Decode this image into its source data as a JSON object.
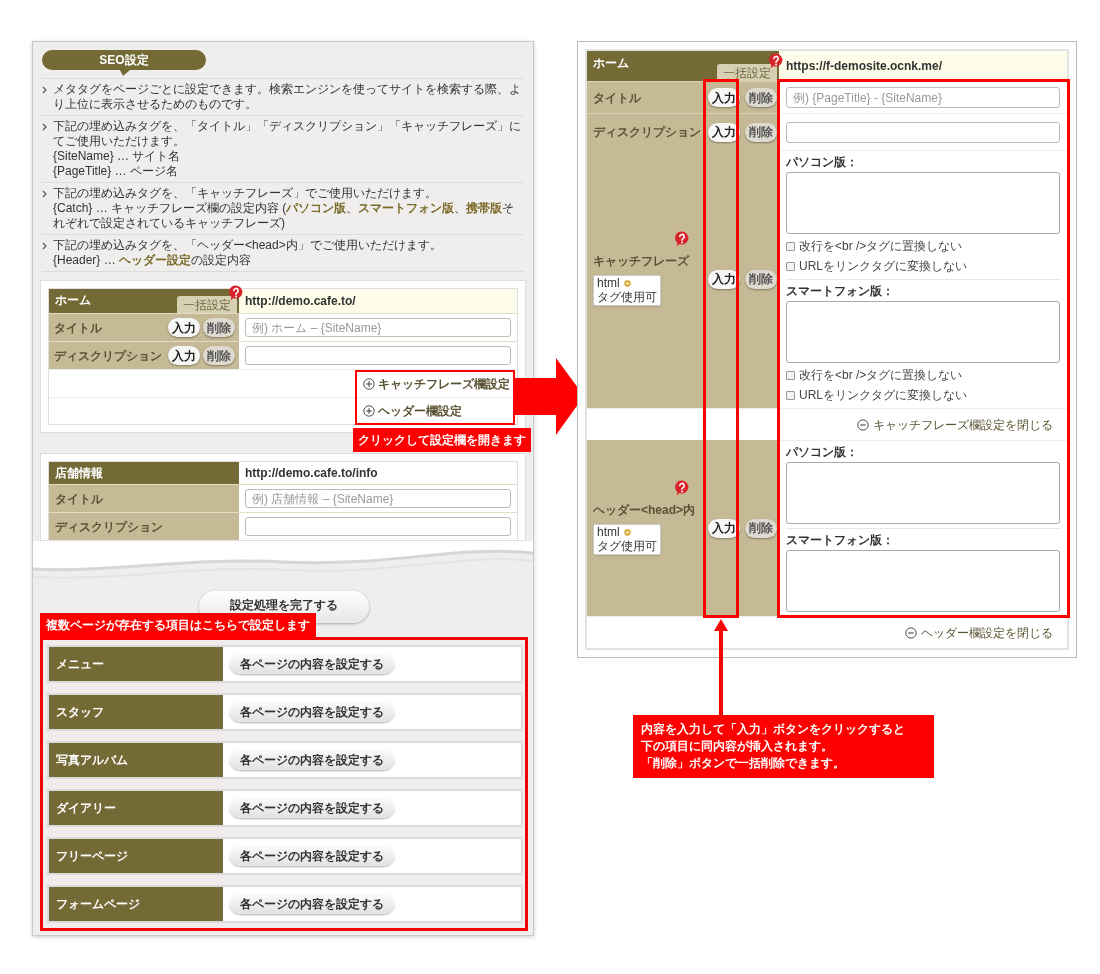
{
  "left_panel": {
    "section_title": "SEO設定",
    "notes": [
      {
        "lines": [
          [
            {
              "kind": "plain",
              "text": "メタタグをページごとに設定できます。検索エンジンを使ってサイトを検索する際、より上位に表示させるためのものです。"
            }
          ]
        ]
      },
      {
        "lines": [
          [
            {
              "kind": "plain",
              "text": "下記の埋め込みタグを、「タイトル」「ディスクリプション」「キャッチフレーズ」にてご使用いただけます。"
            }
          ],
          [
            {
              "kind": "plain",
              "text": "{SiteName} … サイト名"
            }
          ],
          [
            {
              "kind": "plain",
              "text": "{PageTitle} … ページ名"
            }
          ]
        ]
      },
      {
        "lines": [
          [
            {
              "kind": "plain",
              "text": "下記の埋め込みタグを、「キャッチフレーズ」でご使用いただけます。"
            }
          ],
          [
            {
              "kind": "plain",
              "text": "{Catch} … キャッチフレーズ欄の設定内容 ("
            },
            {
              "kind": "link",
              "text": "パソコン版"
            },
            {
              "kind": "plain",
              "text": "、"
            },
            {
              "kind": "link",
              "text": "スマートフォン版"
            },
            {
              "kind": "plain",
              "text": "、"
            },
            {
              "kind": "link",
              "text": "携帯版"
            },
            {
              "kind": "plain",
              "text": "それぞれで設定されているキャッチフレーズ)"
            }
          ]
        ]
      },
      {
        "lines": [
          [
            {
              "kind": "plain",
              "text": "下記の埋め込みタグを、「ヘッダー<head>内」でご使用いただけます。"
            }
          ],
          [
            {
              "kind": "plain",
              "text": "{Header} … "
            },
            {
              "kind": "link",
              "text": "ヘッダー設定"
            },
            {
              "kind": "plain",
              "text": "の設定内容"
            }
          ]
        ]
      }
    ],
    "home": {
      "name": "ホーム",
      "bulk_label": "一括設定",
      "url": "http://demo.cafe.to/",
      "rows": [
        {
          "label": "タイトル",
          "input_button": "入力",
          "delete_button": "削除",
          "placeholder": "例) ホーム – {SiteName}"
        },
        {
          "label": "ディスクリプション",
          "input_button": "入力",
          "delete_button": "削除"
        }
      ],
      "links": [
        "キャッチフレーズ欄設定",
        "ヘッダー欄設定"
      ]
    },
    "shop": {
      "name": "店舗情報",
      "url": "http://demo.cafe.to/info",
      "rows": [
        {
          "label": "タイトル",
          "placeholder": "例) 店舗情報 – {SiteName}"
        },
        {
          "label": "ディスクリプション"
        }
      ]
    },
    "complete_button": "設定処理を完了する",
    "multi_pages": [
      {
        "name": "メニュー",
        "button": "各ページの内容を設定する"
      },
      {
        "name": "スタッフ",
        "button": "各ページの内容を設定する"
      },
      {
        "name": "写真アルバム",
        "button": "各ページの内容を設定する"
      },
      {
        "name": "ダイアリー",
        "button": "各ページの内容を設定する"
      },
      {
        "name": "フリーページ",
        "button": "各ページの内容を設定する"
      },
      {
        "name": "フォームページ",
        "button": "各ページの内容を設定する"
      }
    ]
  },
  "right_panel": {
    "name": "ホーム",
    "bulk_label": "一括設定",
    "url": "https://f-demosite.ocnk.me/",
    "rows": [
      {
        "kind": "single",
        "label": "タイトル",
        "input_button": "入力",
        "delete_button": "削除",
        "placeholder": "例) {PageTitle} - {SiteName}"
      },
      {
        "kind": "single",
        "label": "ディスクリプション",
        "input_button": "入力",
        "delete_button": "削除"
      },
      {
        "kind": "multi",
        "label": "キャッチフレーズ",
        "badge": [
          "html",
          "タグ使用可"
        ],
        "input_button": "入力",
        "delete_button": "削除",
        "fields": [
          {
            "label": "パソコン版：",
            "options": [
              {
                "label": "改行を<br />タグに置換しない",
                "checked": false
              },
              {
                "label": "URLをリンクタグに変換しない",
                "checked": false
              }
            ]
          },
          {
            "label": "スマートフォン版：",
            "options": [
              {
                "label": "改行を<br />タグに置換しない",
                "checked": false
              },
              {
                "label": "URLをリンクタグに変換しない",
                "checked": false
              }
            ]
          }
        ],
        "close_link": "キャッチフレーズ欄設定を閉じる"
      },
      {
        "kind": "multi",
        "label": "ヘッダー<head>内",
        "badge": [
          "html",
          "タグ使用可"
        ],
        "input_button": "入力",
        "delete_button": "削除",
        "fields": [
          {
            "label": "パソコン版："
          },
          {
            "label": "スマートフォン版："
          }
        ],
        "close_link": "ヘッダー欄設定を閉じる"
      }
    ]
  },
  "annotations": {
    "open_hint": "クリックして設定欄を開きます",
    "multi_hint": "複数ページが存在する項目はこちらで設定します",
    "bulk_hint": [
      "内容を入力して「入力」ボタンをクリックすると",
      "下の項目に同内容が挿入されます。",
      "「削除」ボタンで一括削除できます。"
    ]
  }
}
